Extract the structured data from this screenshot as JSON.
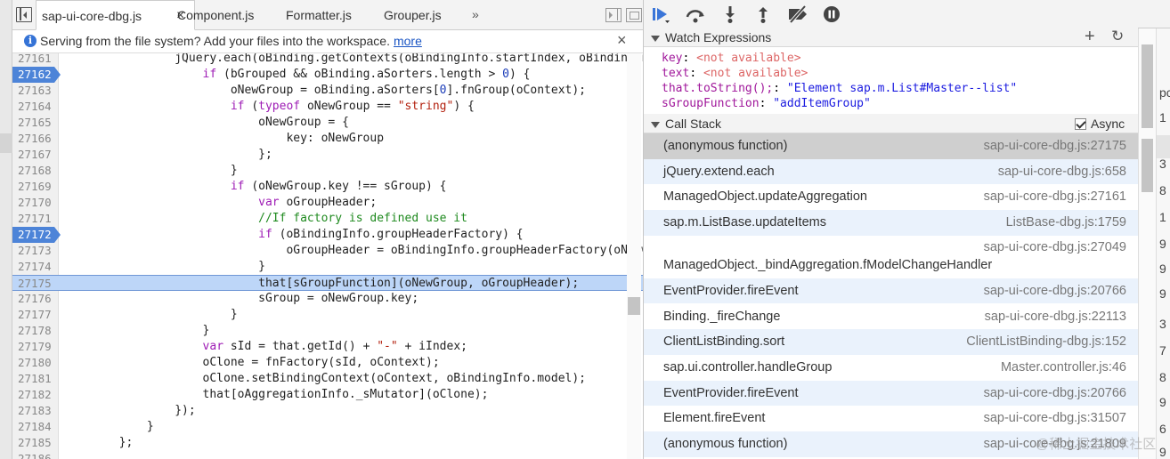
{
  "tabs": [
    {
      "label": "sap-ui-core-dbg.js",
      "active": true
    },
    {
      "label": "Component.js"
    },
    {
      "label": "Formatter.js"
    },
    {
      "label": "Grouper.js"
    }
  ],
  "tab_close_glyph": "×",
  "tab_more": "»",
  "infobar": {
    "message": "Serving from the file system? Add your files into the workspace.",
    "link": "more",
    "close": "×",
    "icon": "i"
  },
  "code": {
    "lines": [
      {
        "n": "27161",
        "t": "                jQuery.each(oBinding.getContexts(oBindingInfo.startIndex, oBindingInfo.length), function(iIndex, oContext) {"
      },
      {
        "n": "27162",
        "t": "                    if (bGrouped && oBinding.aSorters.length > 0) {",
        "bp": true
      },
      {
        "n": "27163",
        "t": "                        oNewGroup = oBinding.aSorters[0].fnGroup(oContext);"
      },
      {
        "n": "27164",
        "t": "                        if (typeof oNewGroup == \"string\") {"
      },
      {
        "n": "27165",
        "t": "                            oNewGroup = {"
      },
      {
        "n": "27166",
        "t": "                                key: oNewGroup"
      },
      {
        "n": "27167",
        "t": "                            };"
      },
      {
        "n": "27168",
        "t": "                        }"
      },
      {
        "n": "27169",
        "t": "                        if (oNewGroup.key !== sGroup) {"
      },
      {
        "n": "27170",
        "t": "                            var oGroupHeader;"
      },
      {
        "n": "27171",
        "t": "                            //If factory is defined use it"
      },
      {
        "n": "27172",
        "t": "                            if (oBindingInfo.groupHeaderFactory) {",
        "bp": true
      },
      {
        "n": "27173",
        "t": "                                oGroupHeader = oBindingInfo.groupHeaderFactory(oNewGroup);"
      },
      {
        "n": "27174",
        "t": "                            }"
      },
      {
        "n": "27175",
        "t": "                            that[sGroupFunction](oNewGroup, oGroupHeader);",
        "hl": true
      },
      {
        "n": "27176",
        "t": "                            sGroup = oNewGroup.key;"
      },
      {
        "n": "27177",
        "t": "                        }"
      },
      {
        "n": "27178",
        "t": "                    }"
      },
      {
        "n": "27179",
        "t": "                    var sId = that.getId() + \"-\" + iIndex;"
      },
      {
        "n": "27180",
        "t": "                    oClone = fnFactory(sId, oContext);"
      },
      {
        "n": "27181",
        "t": "                    oClone.setBindingContext(oContext, oBindingInfo.model);"
      },
      {
        "n": "27182",
        "t": "                    that[oAggregationInfo._sMutator](oClone);"
      },
      {
        "n": "27183",
        "t": "                });"
      },
      {
        "n": "27184",
        "t": "            }"
      },
      {
        "n": "27185",
        "t": "        };"
      },
      {
        "n": "27186",
        "t": ""
      }
    ]
  },
  "watch": {
    "title": "Watch Expressions",
    "items": [
      {
        "name": "key",
        "value": "<not available>",
        "na": true
      },
      {
        "name": "text",
        "value": "<not available>",
        "na": true
      },
      {
        "name": "that.toString();",
        "value": "\"Element sap.m.List#Master--list\""
      },
      {
        "name": "sGroupFunction",
        "value": "\"addItemGroup\""
      }
    ]
  },
  "callstack": {
    "title": "Call Stack",
    "async_label": "Async",
    "async_checked": true,
    "frames": [
      {
        "fn": "(anonymous function)",
        "loc": "sap-ui-core-dbg.js:27175",
        "selected": true
      },
      {
        "fn": "jQuery.extend.each",
        "loc": "sap-ui-core-dbg.js:658"
      },
      {
        "fn": "ManagedObject.updateAggregation",
        "loc": "sap-ui-core-dbg.js:27161"
      },
      {
        "fn": "sap.m.ListBase.updateItems",
        "loc": "ListBase-dbg.js:1759"
      },
      {
        "fn": "ManagedObject._bindAggregation.fModelChangeHandler",
        "loc": "sap-ui-core-dbg.js:27049",
        "wrap": true
      },
      {
        "fn": "EventProvider.fireEvent",
        "loc": "sap-ui-core-dbg.js:20766"
      },
      {
        "fn": "Binding._fireChange",
        "loc": "sap-ui-core-dbg.js:22113"
      },
      {
        "fn": "ClientListBinding.sort",
        "loc": "ClientListBinding-dbg.js:152"
      },
      {
        "fn": "sap.ui.controller.handleGroup",
        "loc": "Master.controller.js:46"
      },
      {
        "fn": "EventProvider.fireEvent",
        "loc": "sap-ui-core-dbg.js:20766"
      },
      {
        "fn": "Element.fireEvent",
        "loc": "sap-ui-core-dbg.js:31507"
      },
      {
        "fn": "(anonymous function)",
        "loc": "sap-ui-core-dbg.js:21809"
      }
    ]
  },
  "edge_glyphs": [
    "pc",
    "1",
    "3",
    "8",
    "1",
    "9",
    "9",
    "9",
    "3",
    "7",
    "8",
    "9",
    "6",
    "9"
  ],
  "watermark": "@稀土掘金技术社区",
  "icons": {
    "resume": "resume-icon",
    "step_over": "step-over-icon",
    "step_into": "step-into-icon",
    "step_out": "step-out-icon",
    "deactivate": "deactivate-breakpoints-icon",
    "pause_exceptions": "pause-on-exceptions-icon"
  }
}
